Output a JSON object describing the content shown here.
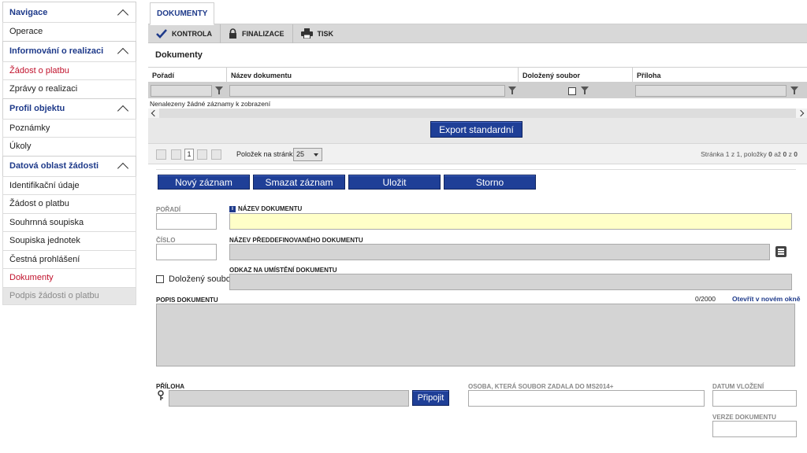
{
  "sidebar": {
    "sections": [
      {
        "title": "Navigace",
        "items": [
          "Operace"
        ]
      },
      {
        "title": "Informování o realizaci",
        "items": [
          "Žádost o platbu",
          "Zprávy o realizaci"
        ]
      },
      {
        "title": "Profil objektu",
        "items": [
          "Poznámky",
          "Úkoly"
        ]
      },
      {
        "title": "Datová oblast žádosti",
        "items": [
          "Identifikační údaje",
          "Žádost o platbu",
          "Souhrnná soupiska",
          "Soupiska jednotek",
          "Čestná prohlášení",
          "Dokumenty",
          "Podpis žádosti o platbu"
        ]
      }
    ]
  },
  "tab": {
    "label": "DOKUMENTY"
  },
  "toolbar": {
    "kontrola": "KONTROLA",
    "finalizace": "FINALIZACE",
    "tisk": "TISK"
  },
  "grid": {
    "title": "Dokumenty",
    "columns": [
      "Pořadí",
      "Název dokumentu",
      "Doložený soubor",
      "Příloha"
    ],
    "empty": "Nenalezeny žádné záznamy k zobrazení"
  },
  "export_label": "Export standardní",
  "pager": {
    "page": "1",
    "per_page_label": "Položek na stránku",
    "per_page": "25",
    "info_prefix": "Stránka 1 z 1, položky ",
    "info_from": "0",
    "info_mid": " až ",
    "info_to": "0",
    "info_mid2": " z ",
    "info_total": "0"
  },
  "actions": {
    "new": "Nový záznam",
    "delete": "Smazat záznam",
    "save": "Uložit",
    "cancel": "Storno"
  },
  "form": {
    "poradi": "POŘADÍ",
    "nazev": "NÁZEV DOKUMENTU",
    "cislo": "ČÍSLO",
    "predef": "NÁZEV PŘEDDEFINOVANÉHO DOKUMENTU",
    "dolozeny": "Doložený soubor",
    "odkaz": "ODKAZ NA UMÍSTĚNÍ DOKUMENTU",
    "popis": "POPIS DOKUMENTU",
    "counter": "0/2000",
    "open_new": "Otevřít v novém okně",
    "priloha": "PŘÍLOHA",
    "pripojit": "Připojit",
    "osoba": "OSOBA, KTERÁ SOUBOR ZADALA DO MS2014+",
    "datum": "DATUM VLOŽENÍ",
    "verze": "VERZE DOKUMENTU"
  }
}
